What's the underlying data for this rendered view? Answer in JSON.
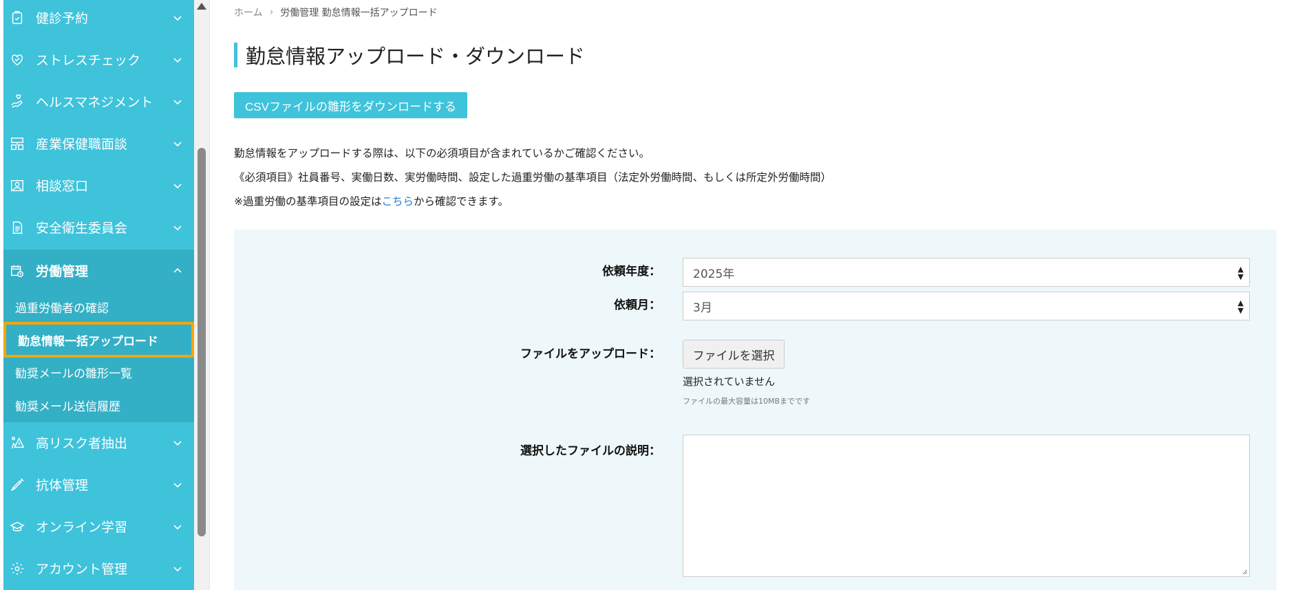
{
  "sidebar": {
    "items": [
      {
        "label": "健診予約",
        "icon": "clipboard-check-icon"
      },
      {
        "label": "ストレスチェック",
        "icon": "heart-check-icon"
      },
      {
        "label": "ヘルスマネジメント",
        "icon": "hand-heart-icon"
      },
      {
        "label": "産業保健職面談",
        "icon": "meeting-icon"
      },
      {
        "label": "相談窓口",
        "icon": "user-card-icon"
      },
      {
        "label": "安全衛生委員会",
        "icon": "document-icon"
      },
      {
        "label": "労働管理",
        "icon": "calendar-clock-icon"
      },
      {
        "label": "高リスク者抽出",
        "icon": "warning-person-icon"
      },
      {
        "label": "抗体管理",
        "icon": "syringe-icon"
      },
      {
        "label": "オンライン学習",
        "icon": "graduation-cap-icon"
      },
      {
        "label": "アカウント管理",
        "icon": "gear-icon"
      }
    ],
    "subitems": [
      {
        "label": "過重労働者の確認"
      },
      {
        "label": "勤怠情報一括アップロード"
      },
      {
        "label": "勧奨メールの雛形一覧"
      },
      {
        "label": "勧奨メール送信履歴"
      }
    ]
  },
  "breadcrumb": {
    "home": "ホーム",
    "separator": "›",
    "current": "労働管理 勤怠情報一括アップロード"
  },
  "page_title": "勤怠情報アップロード・ダウンロード",
  "download_button": "CSVファイルの雛形をダウンロードする",
  "notes": {
    "line1": "勤怠情報をアップロードする際は、以下の必須項目が含まれているかご確認ください。",
    "line2": "《必須項目》社員番号、実働日数、実労働時間、設定した過重労働の基準項目（法定外労働時間、もしくは所定外労働時間）",
    "line3_prefix": "※過重労働の基準項目の設定は",
    "line3_link": "こちら",
    "line3_suffix": "から確認できます。"
  },
  "form": {
    "year_label": "依頼年度：",
    "year_value": "2025年",
    "month_label": "依頼月：",
    "month_value": "3月",
    "file_label": "ファイルをアップロード：",
    "file_button": "ファイルを選択",
    "file_status": "選択されていません",
    "file_hint": "ファイルの最大容量は10MBまでです",
    "description_label": "選択したファイルの説明："
  },
  "colors": {
    "accent": "#3ec3db",
    "highlight": "#f5a50c",
    "panel": "#eef8fa",
    "link": "#2a7fd4"
  }
}
